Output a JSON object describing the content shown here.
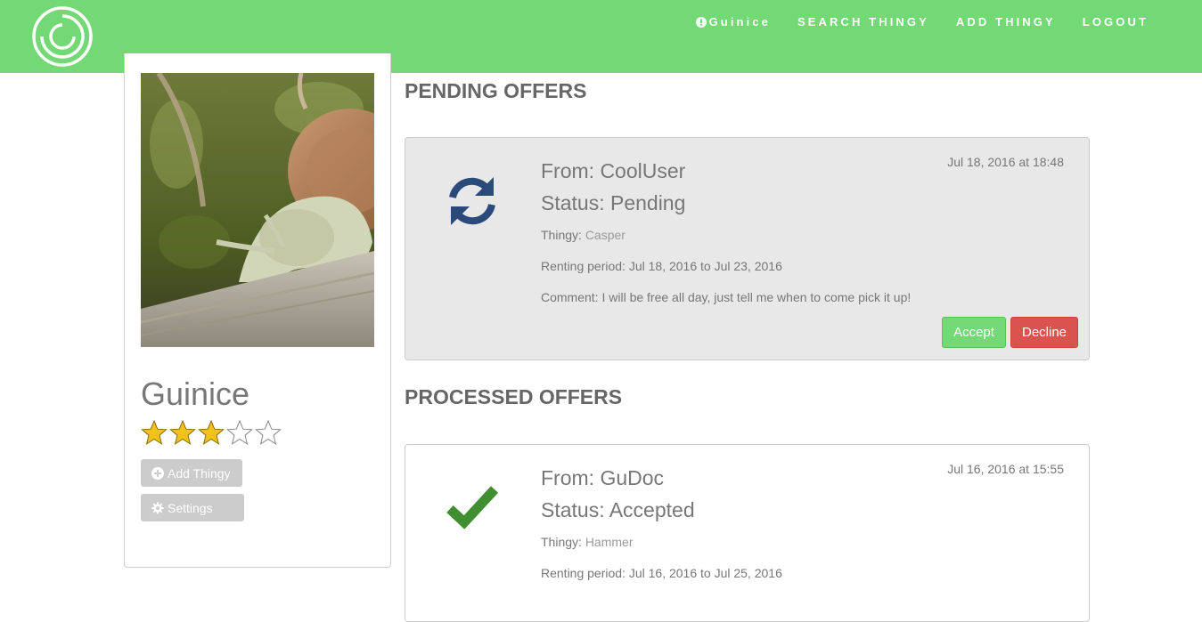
{
  "nav": {
    "user_label": "Guinice",
    "search_label": "SEARCH THINGY",
    "add_label": "ADD THINGY",
    "logout_label": "LOGOUT"
  },
  "profile": {
    "username": "Guinice",
    "rating": 3,
    "rating_max": 5,
    "add_thingy_label": "Add Thingy",
    "settings_label": "Settings"
  },
  "pending": {
    "title": "PENDING OFFERS",
    "offers": [
      {
        "from": "From: CoolUser",
        "status": "Status: Pending",
        "thingy_label": "Thingy:",
        "thingy": "Casper",
        "period": "Renting period: Jul 18, 2016 to Jul 23, 2016",
        "comment": "Comment: I will be free all day, just tell me when to come pick it up!",
        "date": "Jul 18, 2016 at 18:48",
        "accept_label": "Accept",
        "decline_label": "Decline",
        "icon": "refresh-icon"
      }
    ]
  },
  "processed": {
    "title": "PROCESSED OFFERS",
    "offers": [
      {
        "from": "From: GuDoc",
        "status": "Status: Accepted",
        "thingy_label": "Thingy:",
        "thingy": "Hammer",
        "period": "Renting period: Jul 16, 2016 to Jul 25, 2016",
        "date": "Jul 16, 2016 at 15:55",
        "icon": "check-icon"
      }
    ]
  },
  "colors": {
    "navbar": "#73d975",
    "accept": "#73d975",
    "decline": "#d9534f",
    "refresh_icon": "#2a4a7b",
    "check_icon": "#3f8e2f",
    "star": "#f2c21b"
  }
}
